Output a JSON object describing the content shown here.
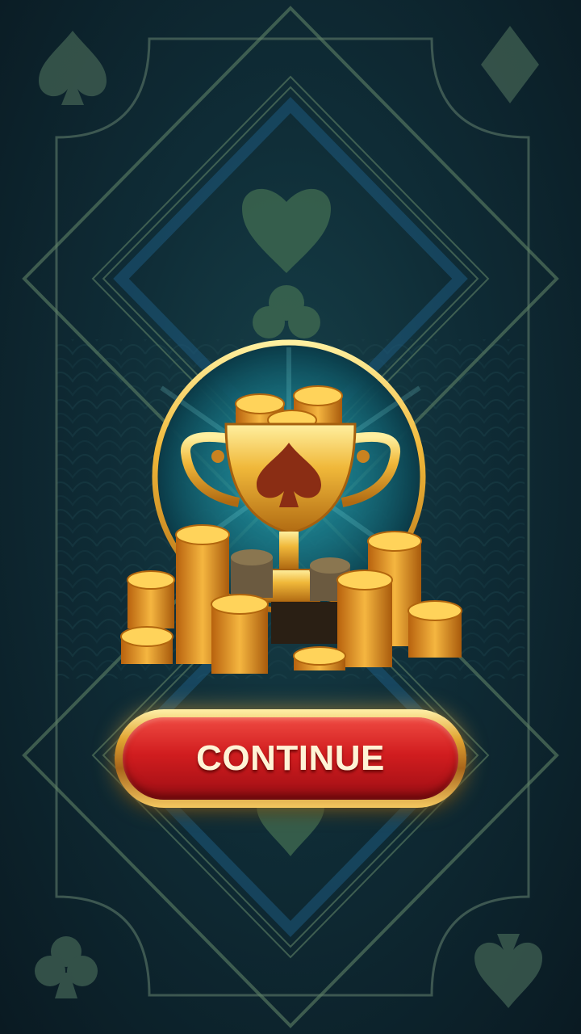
{
  "screen": {
    "continue_label": "CONTINUE"
  },
  "decorations": {
    "corner_suits": [
      "spade",
      "diamond",
      "club",
      "spade"
    ],
    "center_suits": [
      "heart",
      "club",
      "spade"
    ],
    "trophy_emblem": "spade",
    "reward_icon": "trophy-with-gold-coins"
  },
  "colors": {
    "background": "#0f2c36",
    "frame_line": "#6f8a6a",
    "gold": "#e8b43c",
    "button_red": "#d11d1f",
    "button_text": "#fff3d6"
  }
}
